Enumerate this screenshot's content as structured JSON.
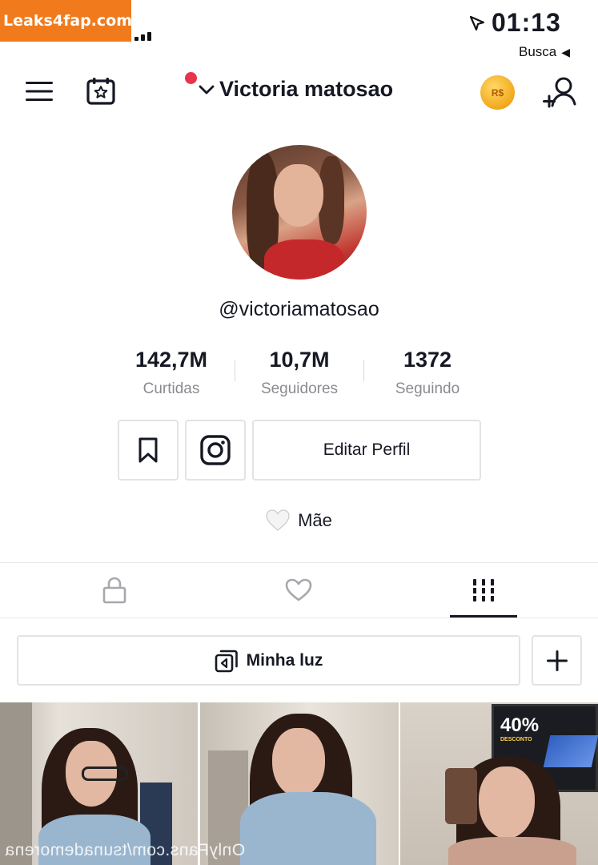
{
  "watermark": {
    "text": "Leaks4fap.com"
  },
  "status_bar": {
    "time": "01:13",
    "back_link": "Busca"
  },
  "header": {
    "username": "Victoria matosao",
    "coin_label": "R$"
  },
  "profile": {
    "handle": "@victoriamatosao",
    "stats": [
      {
        "value": "1372",
        "label": "Seguindo"
      },
      {
        "value": "10,7M",
        "label": "Seguidores"
      },
      {
        "value": "142,7M",
        "label": "Curtidas"
      }
    ],
    "edit_button": "Editar Perfil",
    "bio": "Mãe"
  },
  "playlist": {
    "label": "Minha luz"
  },
  "overlay_text": "OnlyFans.com/tsunademorena",
  "thumbnail_sign": "40%",
  "thumbnail_sign_sub": "DESCONTO",
  "icons": [
    "menu-icon",
    "calendar-star-icon",
    "chevron-down-icon",
    "coin-icon",
    "add-user-icon",
    "instagram-icon",
    "bookmark-icon",
    "lock-icon",
    "heart-icon",
    "grid-icon",
    "playlist-icon",
    "plus-icon",
    "white-heart-icon",
    "location-arrow-icon"
  ]
}
